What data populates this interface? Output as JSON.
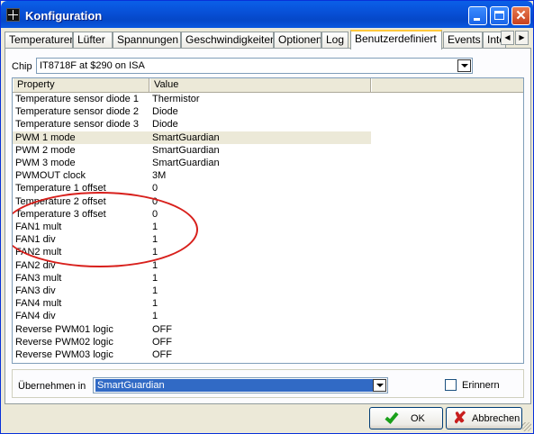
{
  "window": {
    "title": "Konfiguration"
  },
  "tabs": [
    {
      "label": "Temperaturen"
    },
    {
      "label": "Lüfter"
    },
    {
      "label": "Spannungen"
    },
    {
      "label": "Geschwindigkeiten"
    },
    {
      "label": "Optionen"
    },
    {
      "label": "Log"
    },
    {
      "label": "Benutzerdefiniert"
    },
    {
      "label": "Events"
    },
    {
      "label": "Inte"
    }
  ],
  "active_tab": "Benutzerdefiniert",
  "chip": {
    "label": "Chip",
    "value": "IT8718F at $290 on ISA"
  },
  "grid": {
    "columns": [
      "Property",
      "Value"
    ],
    "rows": [
      {
        "property": "Temperature sensor diode 1",
        "value": "Thermistor"
      },
      {
        "property": "Temperature sensor diode 2",
        "value": "Diode"
      },
      {
        "property": "Temperature sensor diode 3",
        "value": "Diode"
      },
      {
        "property": "PWM 1 mode",
        "value": "SmartGuardian"
      },
      {
        "property": "PWM 2 mode",
        "value": "SmartGuardian"
      },
      {
        "property": "PWM 3 mode",
        "value": "SmartGuardian"
      },
      {
        "property": "PWMOUT clock",
        "value": "3M"
      },
      {
        "property": "Temperature 1 offset",
        "value": "0"
      },
      {
        "property": "Temperature 2 offset",
        "value": "0"
      },
      {
        "property": "Temperature 3 offset",
        "value": "0"
      },
      {
        "property": "FAN1 mult",
        "value": "1"
      },
      {
        "property": "FAN1 div",
        "value": "1"
      },
      {
        "property": "FAN2 mult",
        "value": "1"
      },
      {
        "property": "FAN2 div",
        "value": "1"
      },
      {
        "property": "FAN3 mult",
        "value": "1"
      },
      {
        "property": "FAN3 div",
        "value": "1"
      },
      {
        "property": "FAN4 mult",
        "value": "1"
      },
      {
        "property": "FAN4 div",
        "value": "1"
      },
      {
        "property": "Reverse PWM01 logic",
        "value": "OFF"
      },
      {
        "property": "Reverse PWM02 logic",
        "value": "OFF"
      },
      {
        "property": "Reverse PWM03 logic",
        "value": "OFF"
      }
    ],
    "selected_row": "PWM 1 mode"
  },
  "apply": {
    "label": "Übernehmen in",
    "value": "SmartGuardian"
  },
  "remember": {
    "label": "Erinnern",
    "checked": false
  },
  "buttons": {
    "ok": "OK",
    "cancel": "Abbrechen"
  },
  "colors": {
    "title_bar": "#0a5fe8",
    "annotation_circle": "#d8201c",
    "selection": "#316ac5"
  }
}
